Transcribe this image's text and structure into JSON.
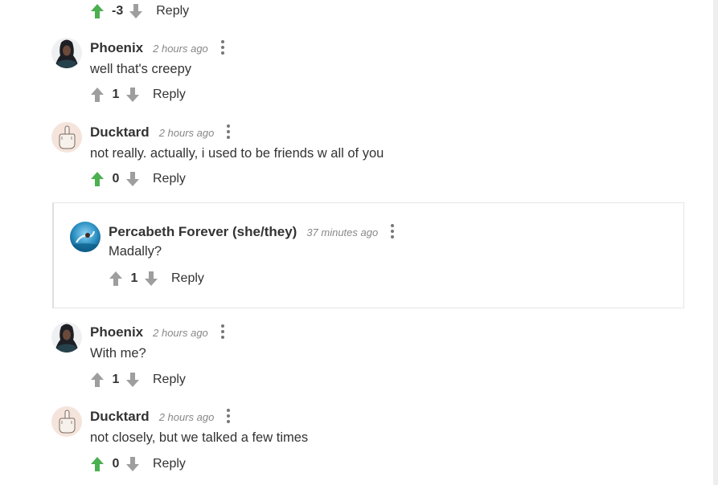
{
  "top_partial": {
    "score": "-3",
    "reply_label": "Reply"
  },
  "comments": [
    {
      "author": "Phoenix",
      "time": "2 hours ago",
      "text": "well that's creepy",
      "score": "1",
      "reply_label": "Reply",
      "upvoted": false
    },
    {
      "author": "Ducktard",
      "time": "2 hours ago",
      "text": "not really. actually, i used to be friends w all of you",
      "score": "0",
      "reply_label": "Reply",
      "upvoted": true
    },
    {
      "author": "Percabeth Forever (she/they)",
      "time": "37 minutes ago",
      "text": "Madally?",
      "score": "1",
      "reply_label": "Reply",
      "upvoted": false
    },
    {
      "author": "Phoenix",
      "time": "2 hours ago",
      "text": "With me?",
      "score": "1",
      "reply_label": "Reply",
      "upvoted": false
    },
    {
      "author": "Ducktard",
      "time": "2 hours ago",
      "text": "not closely, but we talked a few times",
      "score": "0",
      "reply_label": "Reply",
      "upvoted": true
    }
  ],
  "colors": {
    "upvote_active": "#4caf50",
    "vote_inactive": "#9e9e9e",
    "text": "#333333",
    "meta": "#888888"
  },
  "icons": {
    "upvote": "arrow-up-icon",
    "downvote": "arrow-down-icon",
    "menu": "more-vertical-icon"
  }
}
